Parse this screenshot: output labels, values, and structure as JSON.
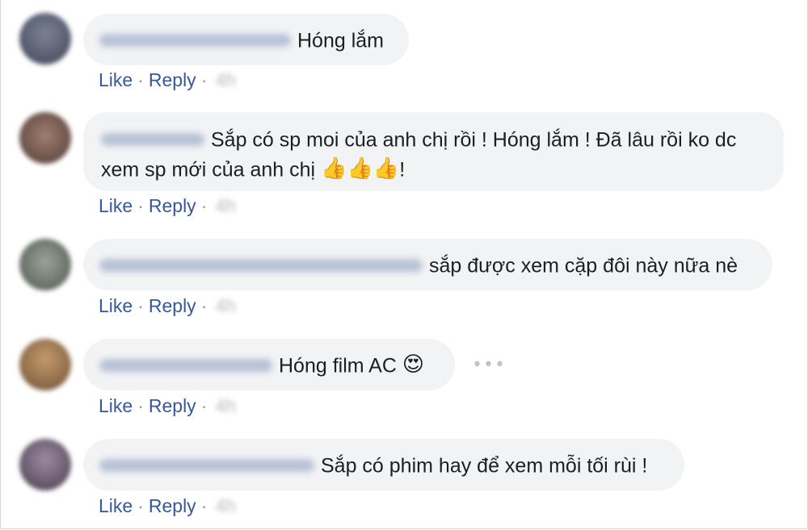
{
  "comments": [
    {
      "message": "Hóng lắm",
      "emojis": "",
      "avatar_color": "#545b6d",
      "like_label": "Like",
      "reply_label": "Reply",
      "time": "4h"
    },
    {
      "message_line1": "Sắp có sp moi của anh chị rồi ! Hóng lắm ! Đã lâu rồi ko dc",
      "message_line2": "xem sp mới của anh chị",
      "emojis": "👍👍👍",
      "suffix": "!",
      "avatar_color": "#7a5a4e",
      "like_label": "Like",
      "reply_label": "Reply",
      "time": "4h"
    },
    {
      "message": "sắp được xem cặp đôi này nữa nè",
      "emojis": "",
      "avatar_color": "#6b7466",
      "like_label": "Like",
      "reply_label": "Reply",
      "time": "4h"
    },
    {
      "message": "Hóng film AC",
      "emojis": "😍",
      "avatar_color": "#9a7652",
      "like_label": "Like",
      "reply_label": "Reply",
      "time": "4h"
    },
    {
      "message": "Sắp có phim hay để xem mỗi tối rùi !",
      "emojis": "",
      "avatar_color": "#6a5a6e",
      "like_label": "Like",
      "reply_label": "Reply",
      "time": "4h"
    }
  ],
  "colors": {
    "link": "#385898",
    "bubble": "#f2f3f5",
    "text": "#1c1e21",
    "author_blur": "#9fa9c2"
  },
  "more_icon": "more-options-icon"
}
